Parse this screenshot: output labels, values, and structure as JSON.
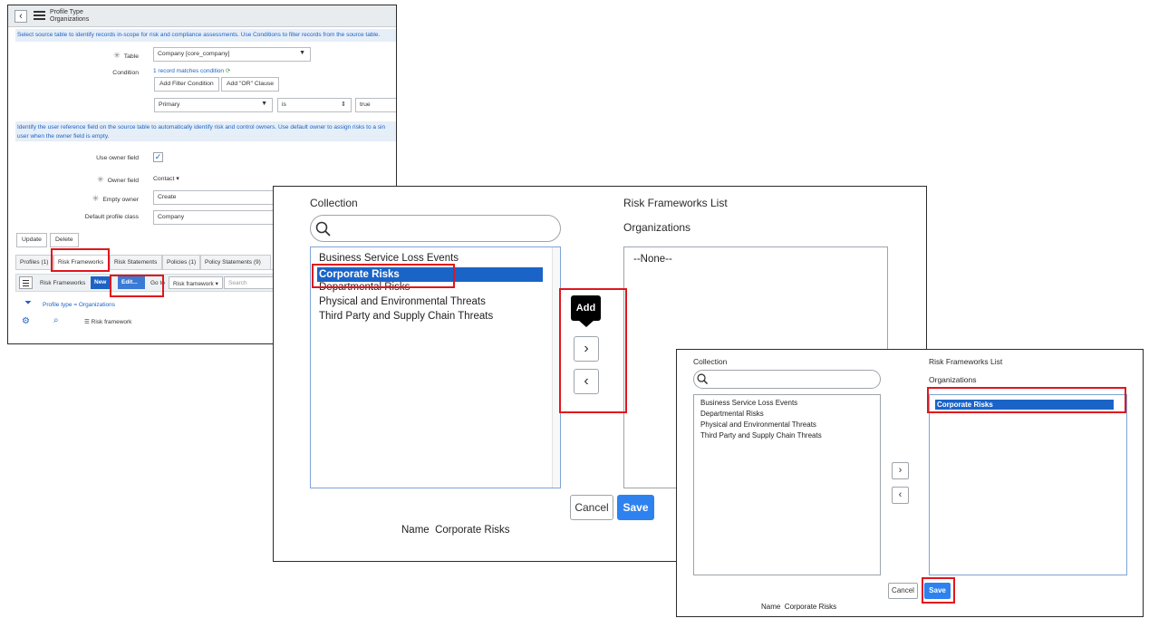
{
  "form": {
    "header": {
      "title": "Profile Type",
      "subtitle": "Organizations"
    },
    "info_source": "Select source table to identify records in-scope for risk and compliance assessments. Use Conditions to filter records from the source table.",
    "table": {
      "label": "Table",
      "value": "Company [core_company]"
    },
    "condition": {
      "label": "Condition",
      "match_text": "1 record matches condition",
      "add_filter": "Add Filter Condition",
      "add_or": "Add \"OR\" Clause",
      "field": "Primary",
      "operator": "is",
      "value": "true"
    },
    "info_owner_line1": "Identify the user reference field on the source table to automatically identify risk and control owners. Use default owner to assign risks to a sin",
    "info_owner_line2": "user when the owner field is empty.",
    "use_owner_field": {
      "label": "Use owner field",
      "checked": "✓"
    },
    "owner_field": {
      "label": "Owner field",
      "value": "Contact"
    },
    "empty_owner": {
      "label": "Empty owner",
      "value": "Create"
    },
    "default_profile_class": {
      "label": "Default profile class",
      "value": "Company"
    },
    "buttons": {
      "update": "Update",
      "delete": "Delete"
    },
    "tabs": [
      "Profiles (1)",
      "Risk Frameworks",
      "Risk Statements",
      "Policies (1)",
      "Policy Statements (9)"
    ],
    "list": {
      "title": "Risk Frameworks",
      "new": "New",
      "edit": "Edit...",
      "goto": "Go to",
      "goto_field": "Risk framework",
      "search_placeholder": "Search",
      "filter": "Profile type = Organizations",
      "column": "Risk framework"
    }
  },
  "slush_large": {
    "collection_label": "Collection",
    "list_label": "Risk Frameworks List",
    "list_sublabel": "Organizations",
    "items": [
      "Business Service Loss Events",
      "Corporate Risks",
      "Departmental Risks",
      "Physical and Environmental Threats",
      "Third Party and Supply Chain Threats"
    ],
    "selected": "Corporate Risks",
    "right_empty": "--None--",
    "tooltip": "Add",
    "cancel": "Cancel",
    "save": "Save",
    "name_label": "Name",
    "name_value": "Corporate Risks"
  },
  "slush_small": {
    "collection_label": "Collection",
    "list_label": "Risk Frameworks List",
    "list_sublabel": "Organizations",
    "items": [
      "Business Service Loss Events",
      "Departmental Risks",
      "Physical and Environmental Threats",
      "Third Party and Supply Chain Threats"
    ],
    "right_selected": "Corporate Risks",
    "cancel": "Cancel",
    "save": "Save",
    "name_label": "Name",
    "name_value": "Corporate Risks"
  },
  "colors": {
    "accent": "#2d82f0",
    "selection": "#1a64c8",
    "highlight": "#e0161d",
    "info_bg": "#e6eef7"
  }
}
